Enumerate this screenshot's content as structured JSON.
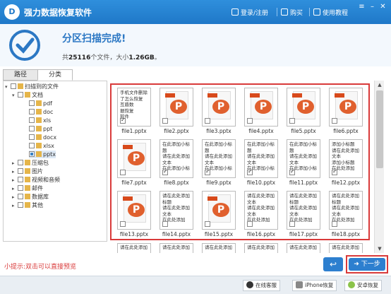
{
  "app": {
    "title": "强力数据恢复软件",
    "logo_text": "D"
  },
  "topbar": {
    "login": "登录/注册",
    "buy": "购买",
    "tutorial": "使用教程"
  },
  "window_controls": {
    "menu": "≡",
    "minimize": "–",
    "close": "✕"
  },
  "scan": {
    "title": "分区扫描完成!",
    "summary_prefix": "共",
    "file_count": "25116",
    "summary_mid": "个文件，大小",
    "total_size": "1.26GB",
    "summary_suffix": "。"
  },
  "tabs": [
    {
      "label": "路径"
    },
    {
      "label": "分类"
    }
  ],
  "tree": {
    "root": "扫描到的文件",
    "documents": "文档",
    "doc_types": [
      "pdf",
      "doc",
      "xls",
      "ppt",
      "docx",
      "xlsx",
      "pptx"
    ],
    "other_categories": [
      "压缩包",
      "图片",
      "视频和音频",
      "邮件",
      "数据库",
      "其他"
    ]
  },
  "files": [
    {
      "name": "file1.pptx",
      "kind": "text",
      "text": "手机文件删除\n了怎么恢复\n互盾数\n据恢复\n软件",
      "checked": true
    },
    {
      "name": "file2.pptx",
      "kind": "icon",
      "checked": false
    },
    {
      "name": "file3.pptx",
      "kind": "icon",
      "checked": false
    },
    {
      "name": "file4.pptx",
      "kind": "icon",
      "checked": false
    },
    {
      "name": "file5.pptx",
      "kind": "icon",
      "checked": false
    },
    {
      "name": "file6.pptx",
      "kind": "icon",
      "checked": false
    },
    {
      "name": "file7.pptx",
      "kind": "icon",
      "checked": false
    },
    {
      "name": "file8.pptx",
      "kind": "text",
      "text": "在此添加小标\n题\n请在此处添加\n文本\n在此添加小标",
      "checked": true
    },
    {
      "name": "file9.pptx",
      "kind": "text",
      "text": "在此添加小标\n题\n请在此处添加\n文本\n在此添加小标",
      "checked": true
    },
    {
      "name": "file10.pptx",
      "kind": "text",
      "text": "在此添加小标\n题\n请在此处添加\n文本\n在此添加小标",
      "checked": true
    },
    {
      "name": "file11.pptx",
      "kind": "text",
      "text": "在此添加小标\n题\n请在此处添加\n文本\n在此添加小标",
      "checked": true
    },
    {
      "name": "file12.pptx",
      "kind": "text",
      "text": "添加小标题\n请在此处添加\n文本\n添加小标题\n在此处添加",
      "checked": true
    },
    {
      "name": "file13.pptx",
      "kind": "icon",
      "checked": false
    },
    {
      "name": "file14.pptx",
      "kind": "text",
      "text": "请在此处添加\n标题\n请在此处添加\n文本\n在此处添加",
      "checked": false
    },
    {
      "name": "file15.pptx",
      "kind": "icon",
      "checked": false
    },
    {
      "name": "file16.pptx",
      "kind": "text",
      "text": "请在此处添加\n文本\n请在此处添加\n文本\n在此处添加",
      "checked": false
    },
    {
      "name": "file17.pptx",
      "kind": "text",
      "text": "请在此处添加\n标题\n请在此处添加\n文本\n在此处添加",
      "checked": false
    },
    {
      "name": "file18.pptx",
      "kind": "text",
      "text": "请在此处添加\n标题\n请在此处添加\n文本\n在此处添加",
      "checked": false
    }
  ],
  "partial_row": [
    "请在此处添加",
    "请在此处添加",
    "请在此处添加",
    "请在此处添加",
    "请在此处添加",
    "请在此处添加"
  ],
  "hint": "小提示:双击可以直接预览",
  "buttons": {
    "back": "↩",
    "next": "下一步"
  },
  "footer": {
    "service": "在线客服",
    "iphone": "iPhone恢复",
    "android": "安卓恢复"
  },
  "colors": {
    "brand": "#1f78c8",
    "highlight": "#d93a3a",
    "ppt_icon": "#e0602e"
  }
}
